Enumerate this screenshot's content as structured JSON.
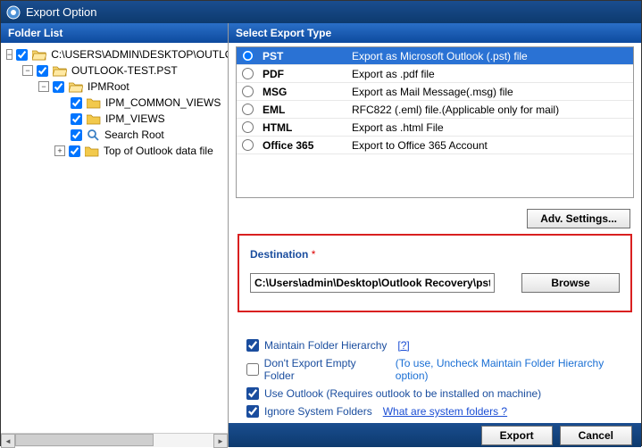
{
  "window": {
    "title": "Export Option"
  },
  "left": {
    "header": "Folder List",
    "tree": [
      {
        "level": 0,
        "toggle": "-",
        "checked": true,
        "icon": "folder-open",
        "label": "C:\\USERS\\ADMIN\\DESKTOP\\OUTLOOK"
      },
      {
        "level": 1,
        "toggle": "-",
        "checked": true,
        "icon": "folder-open",
        "label": "OUTLOOK-TEST.PST"
      },
      {
        "level": 2,
        "toggle": "-",
        "checked": true,
        "icon": "folder-open",
        "label": "IPMRoot"
      },
      {
        "level": 3,
        "toggle": "",
        "checked": true,
        "icon": "folder",
        "label": "IPM_COMMON_VIEWS"
      },
      {
        "level": 3,
        "toggle": "",
        "checked": true,
        "icon": "folder",
        "label": "IPM_VIEWS"
      },
      {
        "level": 3,
        "toggle": "",
        "checked": true,
        "icon": "search",
        "label": "Search Root"
      },
      {
        "level": 3,
        "toggle": "+",
        "checked": true,
        "icon": "folder",
        "label": "Top of Outlook data file"
      }
    ]
  },
  "right": {
    "header": "Select Export Type",
    "exports": [
      {
        "name": "PST",
        "desc": "Export as Microsoft Outlook (.pst) file",
        "selected": true
      },
      {
        "name": "PDF",
        "desc": "Export as .pdf file",
        "selected": false
      },
      {
        "name": "MSG",
        "desc": "Export as Mail Message(.msg) file",
        "selected": false
      },
      {
        "name": "EML",
        "desc": "RFC822 (.eml) file.(Applicable only for mail)",
        "selected": false
      },
      {
        "name": "HTML",
        "desc": "Export as .html File",
        "selected": false
      },
      {
        "name": "Office 365",
        "desc": "Export to Office 365 Account",
        "selected": false
      }
    ],
    "adv_settings": "Adv. Settings...",
    "destination": {
      "label": "Destination",
      "required": "*",
      "value": "C:\\Users\\admin\\Desktop\\Outlook Recovery\\pst",
      "browse": "Browse"
    },
    "options": {
      "maintain": {
        "checked": true,
        "label": "Maintain Folder Hierarchy",
        "help": "[?]"
      },
      "empty": {
        "checked": false,
        "label": "Don't Export Empty Folder",
        "hint": "(To use, Uncheck Maintain Folder Hierarchy option)"
      },
      "outlook": {
        "checked": true,
        "label": "Use Outlook (Requires outlook to be installed on machine)"
      },
      "ignore": {
        "checked": true,
        "label": "Ignore System Folders",
        "link": "What are system folders ?"
      }
    }
  },
  "footer": {
    "export": "Export",
    "cancel": "Cancel"
  }
}
